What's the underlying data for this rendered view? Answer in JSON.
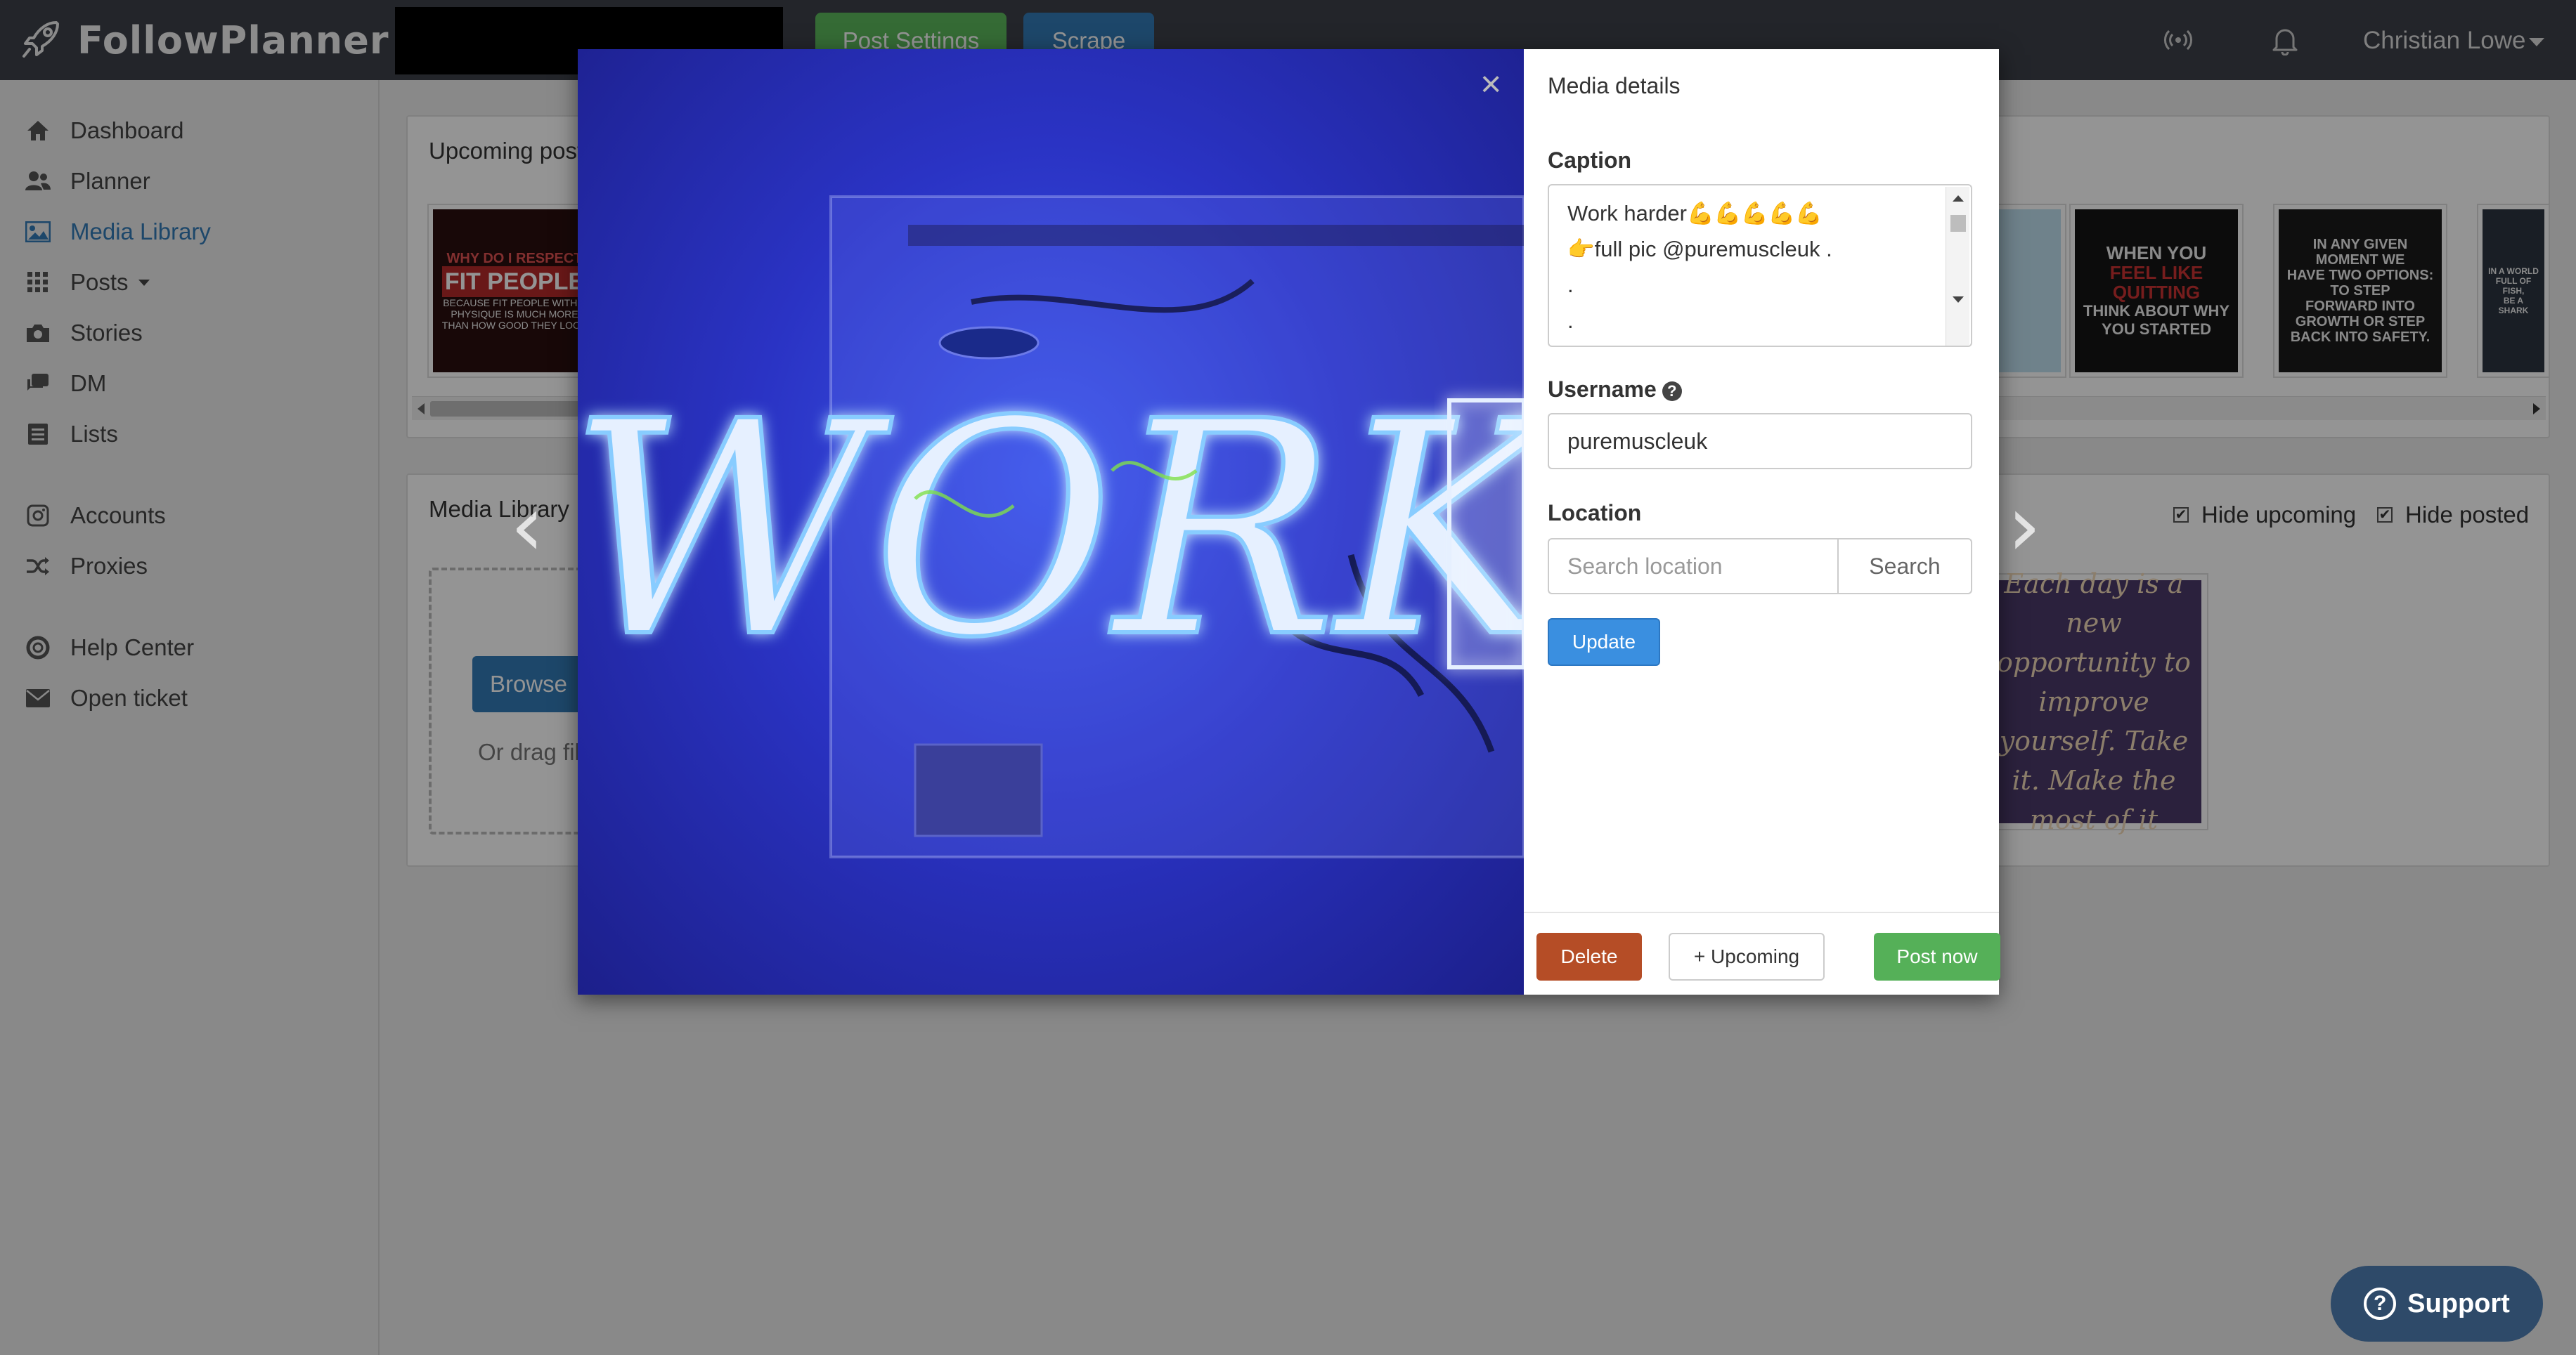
{
  "app": {
    "name": "FollowPlanner"
  },
  "header": {
    "post_settings_label": "Post Settings",
    "scrape_label": "Scrape",
    "user_name": "Christian Lowe"
  },
  "sidebar": {
    "items": [
      {
        "label": "Dashboard",
        "icon": "home-icon"
      },
      {
        "label": "Planner",
        "icon": "users-icon"
      },
      {
        "label": "Media Library",
        "icon": "image-icon",
        "active": true
      },
      {
        "label": "Posts",
        "icon": "grid-icon"
      },
      {
        "label": "Stories",
        "icon": "camera-icon"
      },
      {
        "label": "DM",
        "icon": "chat-icon"
      },
      {
        "label": "Lists",
        "icon": "list-icon"
      },
      {
        "label": "Accounts",
        "icon": "instagram-icon"
      },
      {
        "label": "Proxies",
        "icon": "shuffle-icon"
      },
      {
        "label": "Help Center",
        "icon": "lifebuoy-icon"
      },
      {
        "label": "Open ticket",
        "icon": "envelope-icon"
      }
    ]
  },
  "upcoming": {
    "title": "Upcoming post",
    "thumbs": [
      {
        "line1": "WHY DO I RESPECT",
        "line2": "FIT PEOPLE",
        "line3": "BECAUSE FIT PEOPLE WITH A PHYSIQUE IS MUCH MORE THAN HOW GOOD THEY LOOK"
      },
      {
        "line1": "WHEN YOU",
        "line2": "FEEL LIKE QUITTING",
        "line3": "THINK ABOUT WHY YOU STARTED"
      },
      {
        "line1": "IN ANY GIVEN MOMENT WE",
        "line2": "HAVE TWO OPTIONS: TO STEP",
        "line3": "FORWARD INTO GROWTH OR STEP BACK INTO SAFETY."
      },
      {
        "line1": "IN A WORLD",
        "line2": "FULL OF FISH,",
        "line3": "BE A SHARK"
      }
    ]
  },
  "media_library": {
    "title": "Media Library",
    "browse_label": "Browse",
    "drag_text": "Or drag fil",
    "hide_upcoming_label": "Hide upcoming",
    "hide_posted_label": "Hide posted",
    "quote_text": "Each day is a new opportunity to improve yourself. Take it. Make the most of it"
  },
  "modal": {
    "image_text": "WORK",
    "details_title": "Media details",
    "caption_label": "Caption",
    "caption_lines": [
      "Work harder💪💪💪💪💪",
      "👉full pic @puremuscleuk .",
      ".",
      "."
    ],
    "username_label": "Username",
    "username_value": "puremuscleuk",
    "location_label": "Location",
    "location_placeholder": "Search location",
    "search_label": "Search",
    "update_label": "Update",
    "delete_label": "Delete",
    "upcoming_label": "+ Upcoming",
    "post_now_label": "Post now"
  },
  "support": {
    "label": "Support"
  },
  "colors": {
    "primary": "#337ab7",
    "success": "#5cb85c",
    "danger": "#b54d26",
    "topbar": "#3d4149"
  }
}
